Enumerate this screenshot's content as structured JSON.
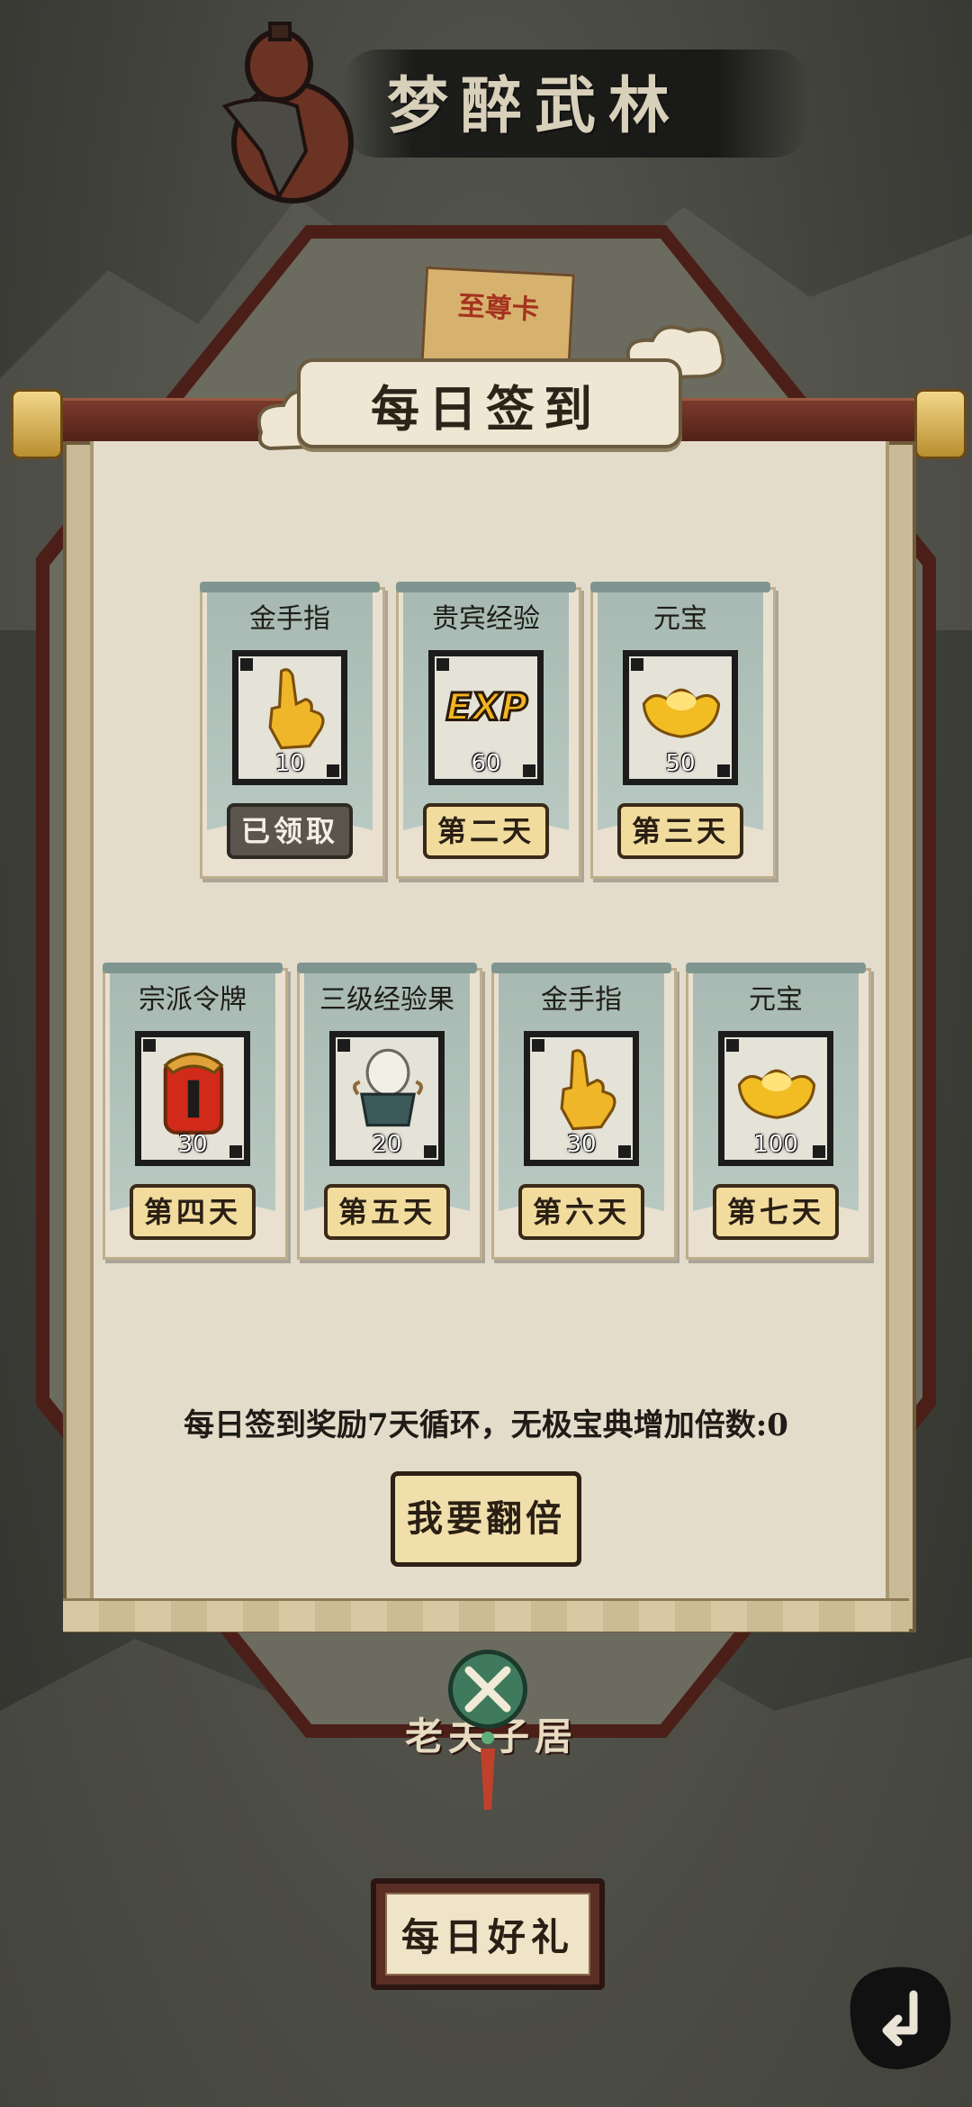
{
  "game": {
    "title": "梦醉武林"
  },
  "background": {
    "card_label": "至尊卡",
    "scene_label": "老夫子居"
  },
  "signin_panel": {
    "title": "每日签到",
    "rewards": [
      {
        "name": "金手指",
        "icon": "golden-finger-icon",
        "quantity": "10",
        "day_label": "已领取",
        "claimed": true
      },
      {
        "name": "贵宾经验",
        "icon": "exp-icon",
        "quantity": "60",
        "day_label": "第二天",
        "claimed": false
      },
      {
        "name": "元宝",
        "icon": "gold-ingot-icon",
        "quantity": "50",
        "day_label": "第三天",
        "claimed": false
      },
      {
        "name": "宗派令牌",
        "icon": "sect-token-icon",
        "quantity": "30",
        "day_label": "第四天",
        "claimed": false
      },
      {
        "name": "三级经验果",
        "icon": "exp-fruit-icon",
        "quantity": "20",
        "day_label": "第五天",
        "claimed": false
      },
      {
        "name": "金手指",
        "icon": "golden-finger-icon",
        "quantity": "30",
        "day_label": "第六天",
        "claimed": false
      },
      {
        "name": "元宝",
        "icon": "gold-ingot-icon",
        "quantity": "100",
        "day_label": "第七天",
        "claimed": false
      }
    ],
    "footer_text": "每日签到奖励7天循环，无极宝典增加倍数:0",
    "double_button": "我要翻倍"
  },
  "bottom": {
    "daily_gift_button": "每日好礼",
    "close_icon": "crossed-swords-close-icon",
    "back_icon": "back-arrow-icon"
  },
  "colors": {
    "button_gold": "#f1dc9e",
    "claimed_gray": "#5a564e",
    "flag_teal": "#a7b9b2",
    "paper": "#e4dccb"
  }
}
